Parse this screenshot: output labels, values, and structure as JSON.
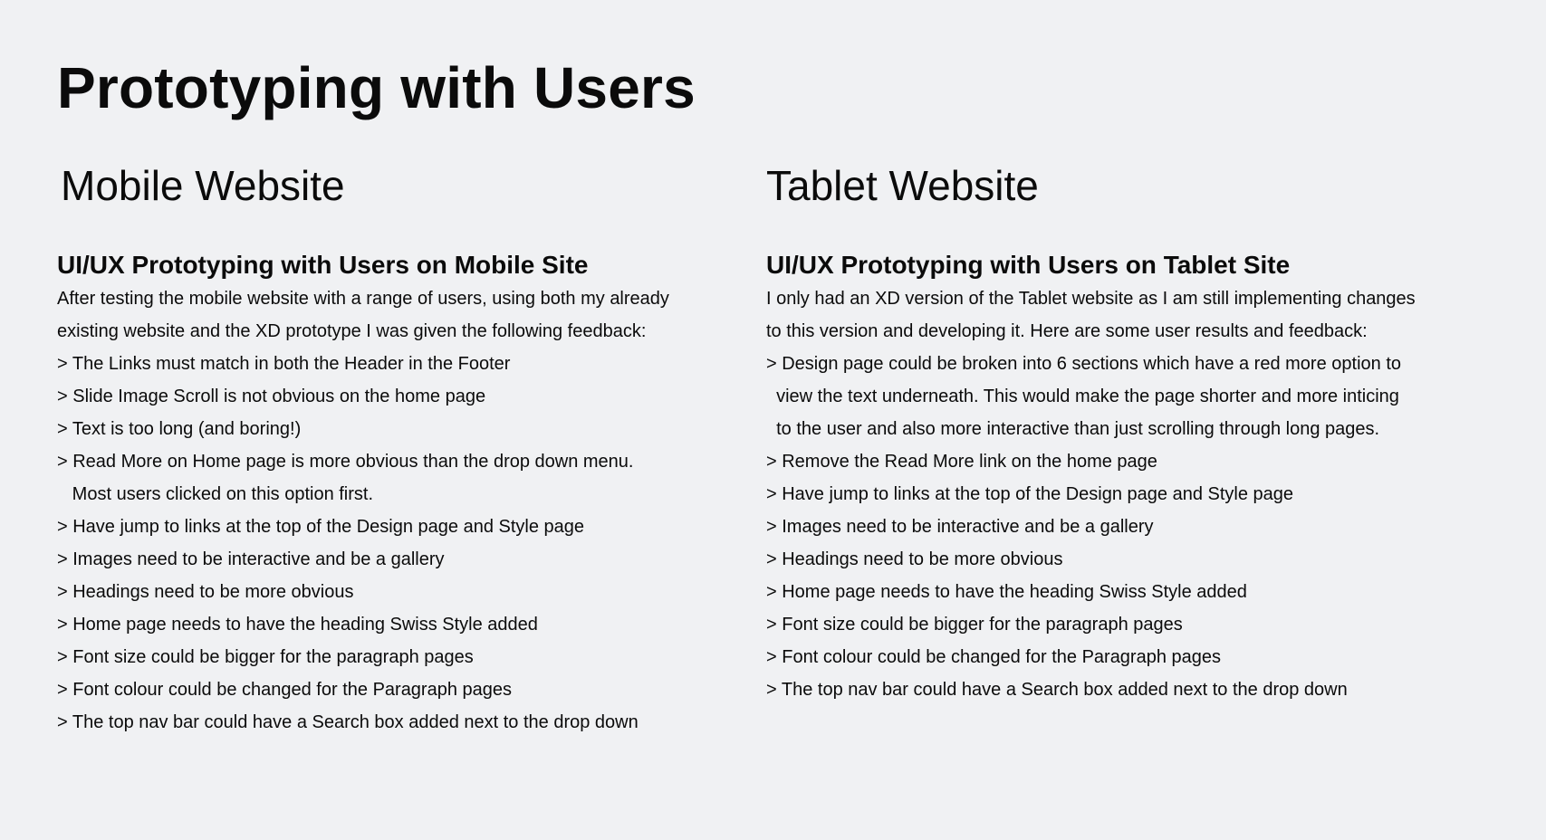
{
  "page": {
    "title": "Prototyping with Users"
  },
  "mobile": {
    "section_title": "Mobile Website",
    "sub_heading": "UI/UX Prototyping with Users on Mobile Site",
    "intro_lines": [
      "After testing the mobile website with a range of users, using both my already",
      "existing website and the XD prototype I was given the following feedback:"
    ],
    "feedback_lines": [
      "> The Links must match in both the Header in the Footer",
      "> Slide Image Scroll is not obvious on the home page",
      "> Text is too long (and boring!)",
      "> Read More on Home page is more obvious than the drop down menu.",
      "   Most users clicked on this option first.",
      "> Have jump to links at the top of the Design page and Style page",
      "> Images need to be interactive and be a gallery",
      "> Headings need to be more obvious",
      "> Home page needs to have the heading Swiss Style added",
      "> Font size could be bigger for the paragraph pages",
      "> Font colour could be changed for the Paragraph pages",
      "> The top nav bar could have a Search box added next to the drop down"
    ]
  },
  "tablet": {
    "section_title": "Tablet Website",
    "sub_heading": "UI/UX Prototyping with Users on Tablet Site",
    "intro_lines": [
      "I only had an XD version of the Tablet website as I am still implementing changes",
      "to this version and developing it. Here are some user results and feedback:"
    ],
    "feedback_lines": [
      "> Design page could be broken into 6 sections which have a red more option to",
      "  view the text underneath. This would make the page shorter and more inticing",
      "  to the user and also more interactive than just scrolling through long pages.",
      "> Remove the Read More link on the home page",
      "> Have jump to links at the top of the Design page and Style page",
      "> Images need to be interactive and be a gallery",
      "> Headings need to be more obvious",
      "> Home page needs to have the heading Swiss Style added",
      "> Font size could be bigger for the paragraph pages",
      "> Font colour could be changed for the Paragraph pages",
      "> The top nav bar could have a Search box added next to the drop down"
    ]
  }
}
